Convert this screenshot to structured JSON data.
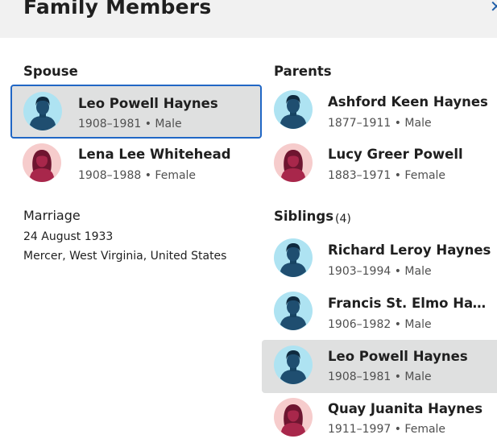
{
  "header": {
    "title": "Family Members",
    "close_glyph": "✕"
  },
  "sections": {
    "spouse": "Spouse",
    "parents": "Parents",
    "siblings": "Siblings",
    "siblings_count": "(4)"
  },
  "spouse": {
    "self": {
      "name": "Leo Powell Haynes",
      "years": "1908–1981",
      "sex": "Male",
      "meta": "1908–1981 • Male"
    },
    "wife": {
      "name": "Lena Lee Whitehead",
      "years": "1908–1988",
      "sex": "Female",
      "meta": "1908–1988 • Female"
    }
  },
  "marriage": {
    "label": "Marriage",
    "date": "24 August 1933",
    "place": "Mercer, West Virginia, United States"
  },
  "parents": [
    {
      "name": "Ashford Keen Haynes",
      "meta": "1877–1911 • Male"
    },
    {
      "name": "Lucy Greer Powell",
      "meta": "1883–1971 • Female"
    }
  ],
  "siblings": [
    {
      "name": "Richard Leroy Haynes",
      "meta": "1903–1994 • Male"
    },
    {
      "name": "Francis St. Elmo Haynes",
      "meta": "1906–1982 • Male"
    },
    {
      "name": "Leo Powell Haynes",
      "meta": "1908–1981 • Male"
    },
    {
      "name": "Quay Juanita Haynes",
      "meta": "1911–1997 • Female"
    }
  ],
  "colors": {
    "accent": "#2167c5",
    "selected_bg": "#dfe0e0",
    "male_avatar_bg": "#aee3f2",
    "male_avatar_fg": "#1f4e70",
    "female_avatar_bg": "#f6cccc",
    "female_avatar_fg": "#a8274b"
  },
  "icons": {
    "male": "male-avatar-icon",
    "female": "female-avatar-icon",
    "close": "close-icon"
  }
}
